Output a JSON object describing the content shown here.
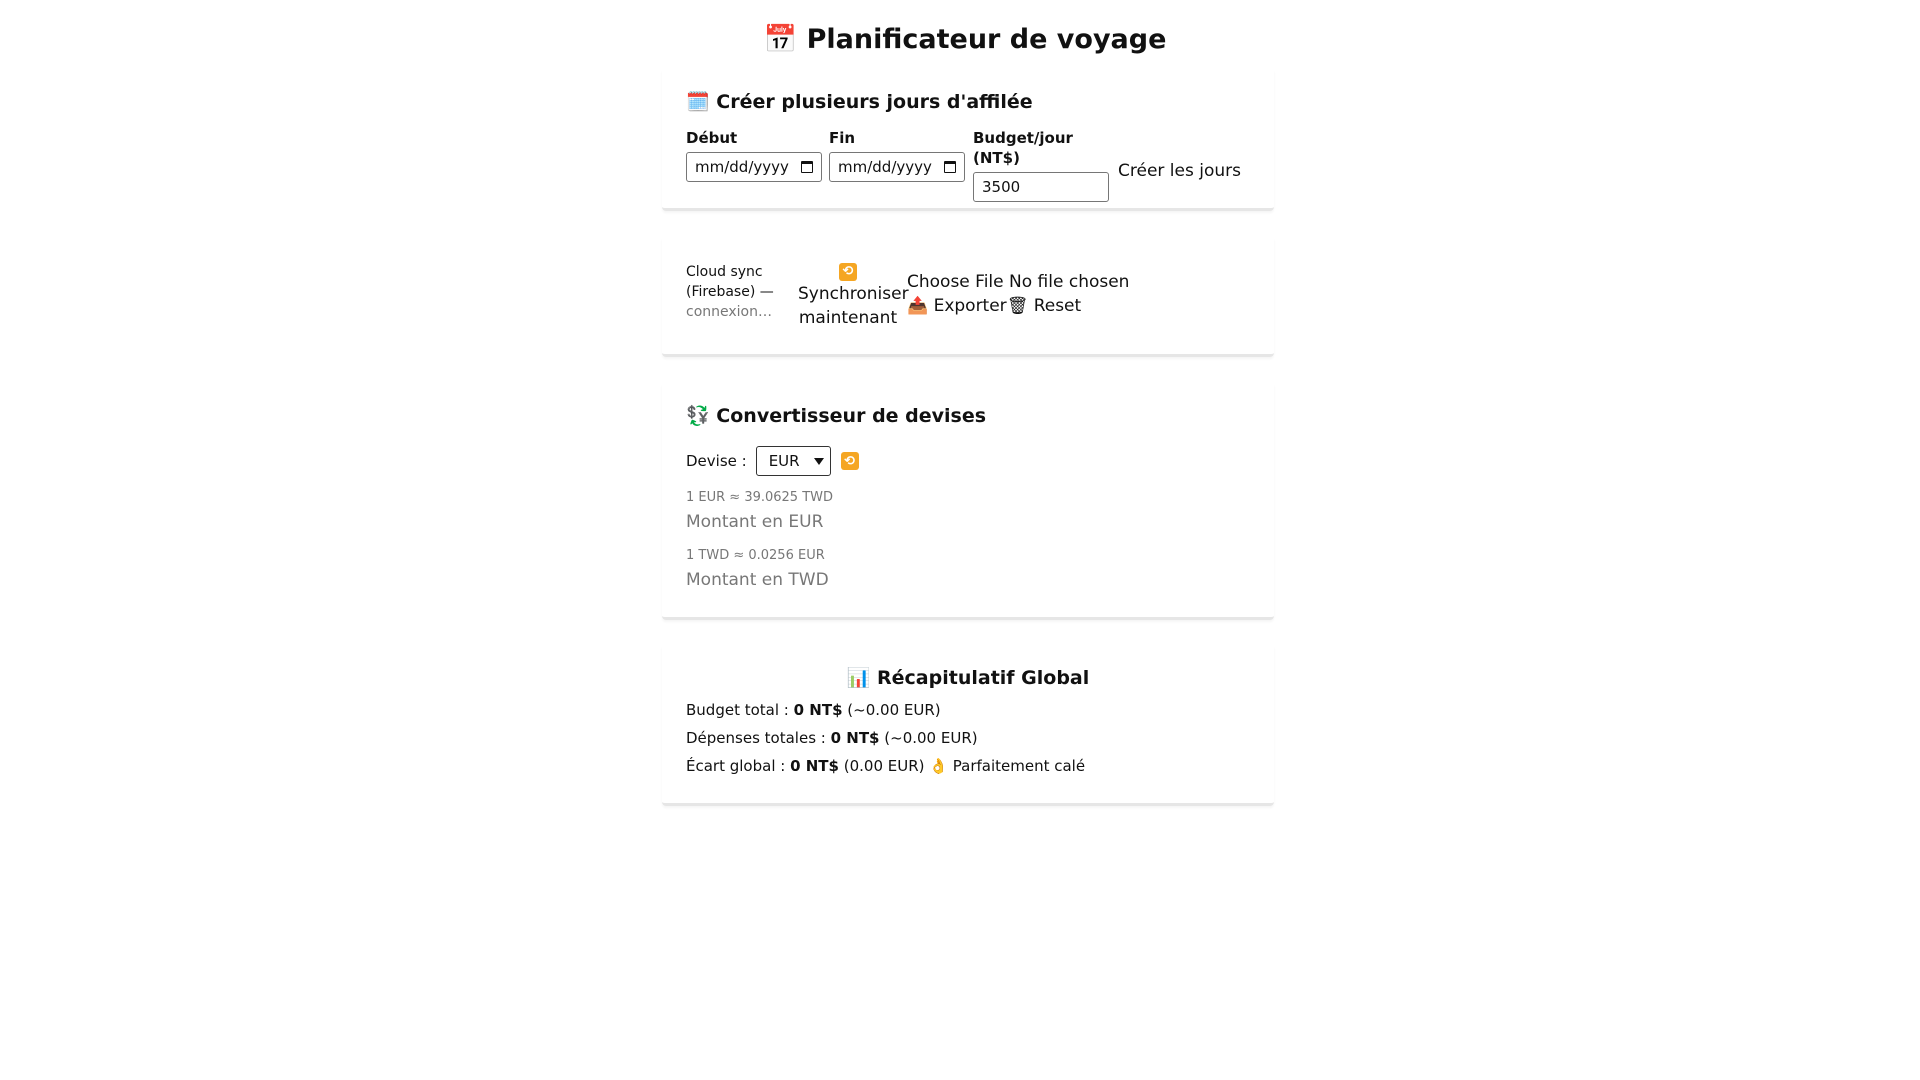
{
  "app": {
    "title_icon": "📅",
    "title": "Planificateur de voyage"
  },
  "create_days": {
    "icon": "🗓️",
    "title": "Créer plusieurs jours d'affilée",
    "start_label": "Début",
    "start_placeholder": "mm/dd/yyyy",
    "end_label": "Fin",
    "end_placeholder": "mm/dd/yyyy",
    "budget_label": "Budget/jour (NT$)",
    "budget_value": "3500",
    "create_button": "Créer les jours"
  },
  "cloud": {
    "status_line1": "Cloud sync",
    "status_line2": "(Firebase) —",
    "status_line3": "connexion…",
    "sync_icon": "🔁",
    "sync_line1": "Synchroniser",
    "sync_line2": "maintenant",
    "choose_file": "Choose File",
    "no_file": "No file chosen",
    "export_icon": "📤",
    "export_label": "Exporter",
    "reset_icon": "🗑",
    "reset_label": "Reset"
  },
  "converter": {
    "icon": "💱",
    "title": "Convertisseur de devises",
    "currency_label": "Devise :",
    "currency_selected": "EUR",
    "rate_eur_twd": "1 EUR ≈ 39.0625 TWD",
    "amount_eur_placeholder": "Montant en EUR",
    "rate_twd_eur": "1 TWD ≈ 0.0256 EUR",
    "amount_twd_placeholder": "Montant en TWD"
  },
  "summary": {
    "icon": "📊",
    "title": "Récapitulatif Global",
    "budget_label": "Budget total :",
    "budget_value": "0 NT$",
    "budget_eur": "(~0.00 EUR)",
    "spent_label": "Dépenses totales :",
    "spent_value": "0 NT$",
    "spent_eur": "(~0.00 EUR)",
    "gap_label": "Écart global :",
    "gap_value": "0 NT$",
    "gap_eur": "(0.00 EUR)",
    "gap_status_icon": "👌",
    "gap_status": "Parfaitement calé"
  },
  "colors": {
    "sync_icon_bg": "#f5a623",
    "muted_text": "#777777",
    "card_border": "#e6e6e6"
  }
}
